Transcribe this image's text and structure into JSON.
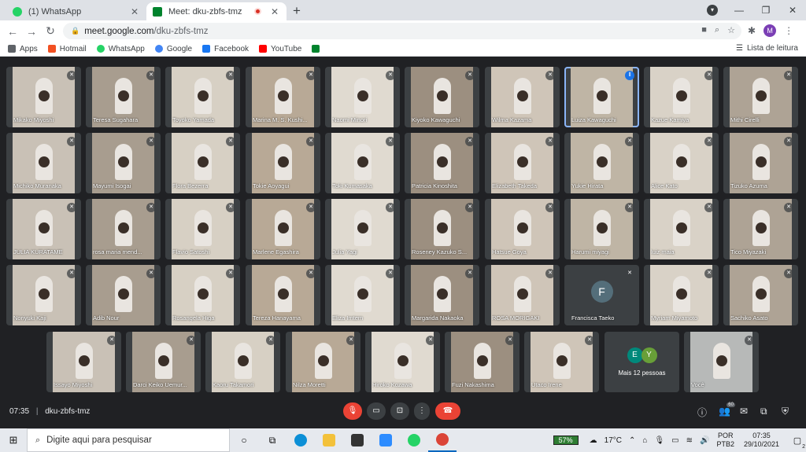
{
  "browser": {
    "tabs": [
      {
        "title": "(1) WhatsApp",
        "favicon_color": "#25d366"
      },
      {
        "title": "Meet: dku-zbfs-tmz",
        "favicon_color": "#00832d"
      }
    ],
    "url_host": "meet.google.com",
    "url_path": "/dku-zbfs-tmz",
    "profile_initial": "M",
    "bookmarks": [
      {
        "label": "Apps",
        "color": "#5f6368"
      },
      {
        "label": "Hotmail",
        "color": "#f25022"
      },
      {
        "label": "WhatsApp",
        "color": "#25d366"
      },
      {
        "label": "Google",
        "color": "#4285f4"
      },
      {
        "label": "Facebook",
        "color": "#1877f2"
      },
      {
        "label": "YouTube",
        "color": "#ff0000"
      }
    ],
    "reading_list": "Lista de leitura"
  },
  "participants": [
    {
      "name": "Mikako Miyoshi"
    },
    {
      "name": "Teresa Sugahara"
    },
    {
      "name": "Toyoko Yamada"
    },
    {
      "name": "Marina M. S. Kushi..."
    },
    {
      "name": "Naomi Minori"
    },
    {
      "name": "Kiyoko Kawaguchi"
    },
    {
      "name": "Wilma Kazama"
    },
    {
      "name": "Luiza Kawaguchi"
    },
    {
      "name": "Kazue Kamiya"
    },
    {
      "name": "Mithi Cirelli"
    },
    {
      "name": "Michiko Muranaka"
    },
    {
      "name": "Mayumi Isogai"
    },
    {
      "name": "Flora Bezerra"
    },
    {
      "name": "Tokie Aoyagui"
    },
    {
      "name": "Toki Kumasaka"
    },
    {
      "name": "Patricia Kinoshita"
    },
    {
      "name": "Elizabeth Takeda"
    },
    {
      "name": "Yukie Hirata"
    },
    {
      "name": "Alice Kato"
    },
    {
      "name": "Tizuko Azuma"
    },
    {
      "name": "JULIA KURATAME"
    },
    {
      "name": "rosa maria mend..."
    },
    {
      "name": "Flavio Satoshi"
    },
    {
      "name": "Marlene Egashira"
    },
    {
      "name": "Julia Yagi"
    },
    {
      "name": "Roseney Kazuko S..."
    },
    {
      "name": "Hatsue Goya"
    },
    {
      "name": "Harumi miyagi"
    },
    {
      "name": "luiz maia"
    },
    {
      "name": "Tico Miyazaki"
    },
    {
      "name": "Noriyuki Kaji"
    },
    {
      "name": "Adib Nour"
    },
    {
      "name": "Rosangela Higa"
    },
    {
      "name": "Tereza Hanayama"
    },
    {
      "name": "Eliza Imtem"
    },
    {
      "name": "Margarida Nakaoka"
    },
    {
      "name": "ROSA MORIGAKI"
    },
    {
      "name": "Francisca Taeko"
    },
    {
      "name": "Myriam Miyamoto"
    },
    {
      "name": "Sachiko Asato"
    },
    {
      "name": "Issayo Miyoshi"
    },
    {
      "name": "Darci Keiko Uemur..."
    },
    {
      "name": "Kaoru Takamori"
    },
    {
      "name": "Nilza Moretti"
    },
    {
      "name": "Hiroko Kozawa"
    },
    {
      "name": "Fuzi Nakashima"
    },
    {
      "name": "Utaco Irene"
    }
  ],
  "avatar_letter": "F",
  "more_tile": {
    "initials": [
      "E",
      "Y"
    ],
    "label": "Mais 12 pessoas"
  },
  "self_tile": {
    "name": "Você"
  },
  "meeting": {
    "time": "07:35",
    "code": "dku-zbfs-tmz",
    "people_badge": "60"
  },
  "taskbar": {
    "search_placeholder": "Digite aqui para pesquisar",
    "battery": "57%",
    "temperature": "17°C",
    "lang1": "POR",
    "lang2": "PTB2",
    "time": "07:35",
    "date": "29/10/2021",
    "notifications": "2"
  }
}
